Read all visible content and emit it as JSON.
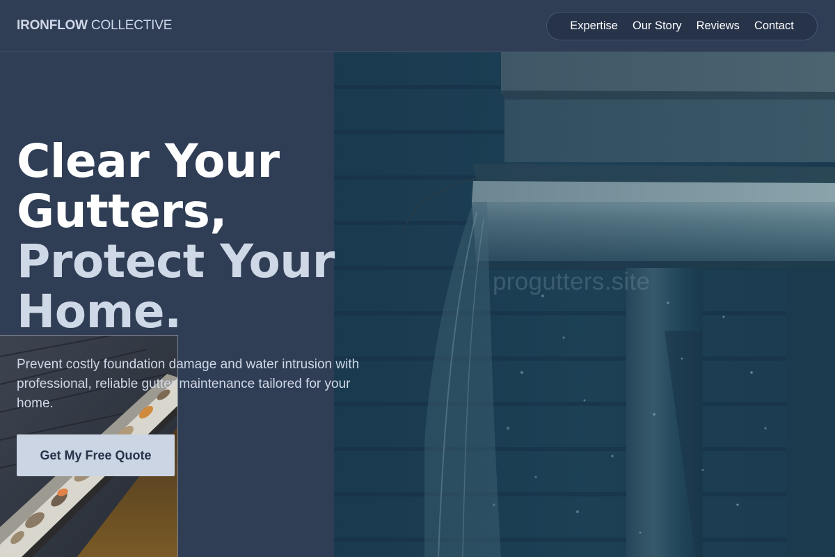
{
  "header": {
    "logo_bold": "IRONFLOW",
    "logo_light": "COLLECTIVE",
    "nav": [
      {
        "label": "Expertise"
      },
      {
        "label": "Our Story"
      },
      {
        "label": "Reviews"
      },
      {
        "label": "Contact"
      }
    ]
  },
  "hero": {
    "headline_lines": [
      "Clear Your",
      "Gutters,",
      "Protect Your",
      "Home."
    ],
    "subtext": "Prevent costly foundation damage and water intrusion with professional, reliable gutter maintenance tailored for your home.",
    "cta_label": "Get My Free Quote",
    "watermark": "progutters.site"
  },
  "colors": {
    "background": "#2f3d55",
    "nav_pill": "#263349",
    "cta_bg": "#cbd5e3",
    "cta_text": "#263349",
    "muted_text": "#cfd8e6"
  }
}
